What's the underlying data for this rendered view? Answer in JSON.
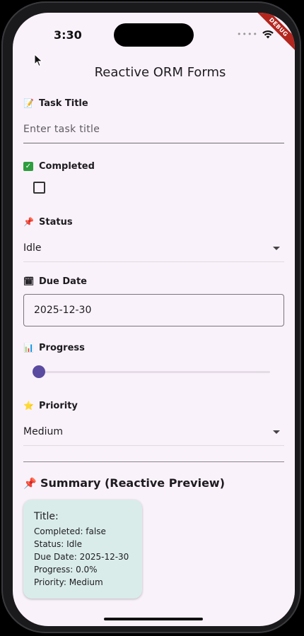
{
  "status_bar": {
    "time": "3:30",
    "debug_label": "DEBUG"
  },
  "appbar": {
    "title": "Reactive ORM Forms"
  },
  "form": {
    "task_title": {
      "label": "Task Title",
      "icon": "memo-icon",
      "placeholder": "Enter task title"
    },
    "completed": {
      "label": "Completed",
      "icon": "check-mark-icon",
      "checked": false
    },
    "status": {
      "label": "Status",
      "icon": "pushpin-icon",
      "value": "Idle"
    },
    "due_date": {
      "label": "Due Date",
      "icon": "calendar-icon",
      "value": "2025-12-30"
    },
    "progress": {
      "label": "Progress",
      "icon": "bar-chart-icon",
      "value": 0.0
    },
    "priority": {
      "label": "Priority",
      "icon": "star-icon",
      "value": "Medium"
    }
  },
  "summary": {
    "heading": "Summary (Reactive Preview)",
    "icon": "pushpin-icon",
    "title_line": "Title:",
    "completed_line": "Completed: false",
    "status_line": "Status: Idle",
    "due_date_line": "Due Date: 2025-12-30",
    "progress_line": "Progress: 0.0%",
    "priority_line": "Priority: Medium"
  },
  "colors": {
    "background": "#faf2fa",
    "accent": "#5a4aa0",
    "card": "#d9ecea"
  }
}
